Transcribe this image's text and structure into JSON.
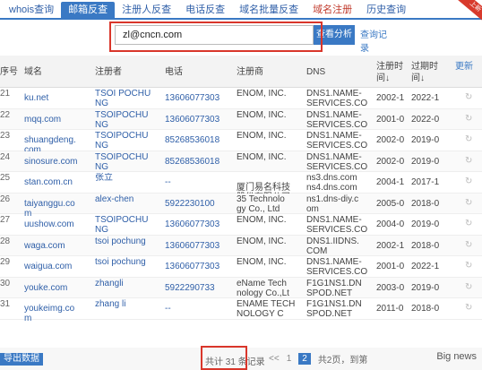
{
  "tabs": [
    {
      "label": "whois查询"
    },
    {
      "label": "邮箱反查"
    },
    {
      "label": "注册人反查"
    },
    {
      "label": "电话反查"
    },
    {
      "label": "域名批量反查"
    },
    {
      "label": "域名注册"
    },
    {
      "label": "历史查询"
    }
  ],
  "ribbon": "上新",
  "search": {
    "value": "zl@cncn.com",
    "button": "查看分析",
    "history": "查询记录"
  },
  "columns": {
    "idx": "序号",
    "domain": "域名",
    "registrant": "注册者",
    "phone": "电话",
    "registrar": "注册商",
    "dns": "DNS",
    "reg_time": "注册时间",
    "exp_time": "过期时间",
    "refresh": "更新"
  },
  "sort_arrows": {
    "reg": "↓",
    "exp": "↓"
  },
  "rows": [
    {
      "idx": "21",
      "domain": "ku.net",
      "registrant": "TSOI POCHU\nNG",
      "phone": "13606077303",
      "registrar": "ENOM, INC.",
      "dns": "DNS1.NAME-\nSERVICES.CO",
      "reg": "2002-1",
      "exp": "2022-1"
    },
    {
      "idx": "22",
      "domain": "mqq.com",
      "registrant": "TSOIPOCHU\nNG",
      "phone": "13606077303",
      "registrar": "ENOM, INC.",
      "dns": "DNS1.NAME-\nSERVICES.CO",
      "reg": "2001-0",
      "exp": "2022-0"
    },
    {
      "idx": "23",
      "domain": "shuangdeng.\ncom",
      "registrant": "TSOIPOCHU\nNG",
      "phone": "85268536018",
      "registrar": "ENOM, INC.",
      "dns": "DNS1.NAME-\nSERVICES.CO",
      "reg": "2002-0",
      "exp": "2019-0"
    },
    {
      "idx": "24",
      "domain": "sinosure.com",
      "registrant": "TSOIPOCHU\nNG",
      "phone": "85268536018",
      "registrar": "ENOM, INC.",
      "dns": "DNS1.NAME-\nSERVICES.CO",
      "reg": "2002-0",
      "exp": "2019-0"
    },
    {
      "idx": "25",
      "domain": "stan.com.cn",
      "registrant": "张立",
      "phone": "--",
      "registrar": "\n厦门易名科技\n股份有限公司",
      "dns": "ns3.dns.com\nns4.dns.com",
      "reg": "2004-1",
      "exp": "2017-1"
    },
    {
      "idx": "26",
      "domain": "taiyanggu.co\nm",
      "registrant": "alex-chen",
      "phone": "5922230100",
      "registrar": "35 Technolo\ngy Co., Ltd",
      "dns": "ns1.dns-diy.c\nom",
      "reg": "2005-0",
      "exp": "2018-0"
    },
    {
      "idx": "27",
      "domain": "uushow.com",
      "registrant": "TSOIPOCHU\nNG",
      "phone": "13606077303",
      "registrar": "ENOM, INC.",
      "dns": "DNS1.NAME-\nSERVICES.CO",
      "reg": "2004-0",
      "exp": "2019-0"
    },
    {
      "idx": "28",
      "domain": "waga.com",
      "registrant": "tsoi pochung",
      "phone": "13606077303",
      "registrar": "ENOM, INC.",
      "dns": "DNS1.IIDNS.\nCOM",
      "reg": "2002-1",
      "exp": "2018-0"
    },
    {
      "idx": "29",
      "domain": "waigua.com",
      "registrant": "tsoi pochung",
      "phone": "13606077303",
      "registrar": "ENOM, INC.",
      "dns": "DNS1.NAME-\nSERVICES.CO",
      "reg": "2001-0",
      "exp": "2022-1"
    },
    {
      "idx": "30",
      "domain": "youke.com",
      "registrant": "zhangli",
      "phone": "5922290733",
      "registrar": "eName Tech\nnology Co.,Lt",
      "dns": "F1G1NS1.DN\nSPOD.NET",
      "reg": "2003-0",
      "exp": "2019-0"
    },
    {
      "idx": "31",
      "domain": "youkeimg.co\nm",
      "registrant": "zhang li",
      "phone": "--",
      "registrar": "ENAME TECH\nNOLOGY C",
      "dns": "F1G1NS1.DN\nSPOD.NET",
      "reg": "2011-0",
      "exp": "2018-0"
    }
  ],
  "refresh_icon": "refresh-icon",
  "footer": {
    "export": "导出数据",
    "total": "共计 31 条记录",
    "prev": "<<",
    "page1": "1",
    "page2": "2",
    "page_info": "共2页，到第",
    "watermark": "Big news"
  },
  "colors": {
    "accent": "#3a79c4",
    "highlight_box": "#d9362b"
  }
}
